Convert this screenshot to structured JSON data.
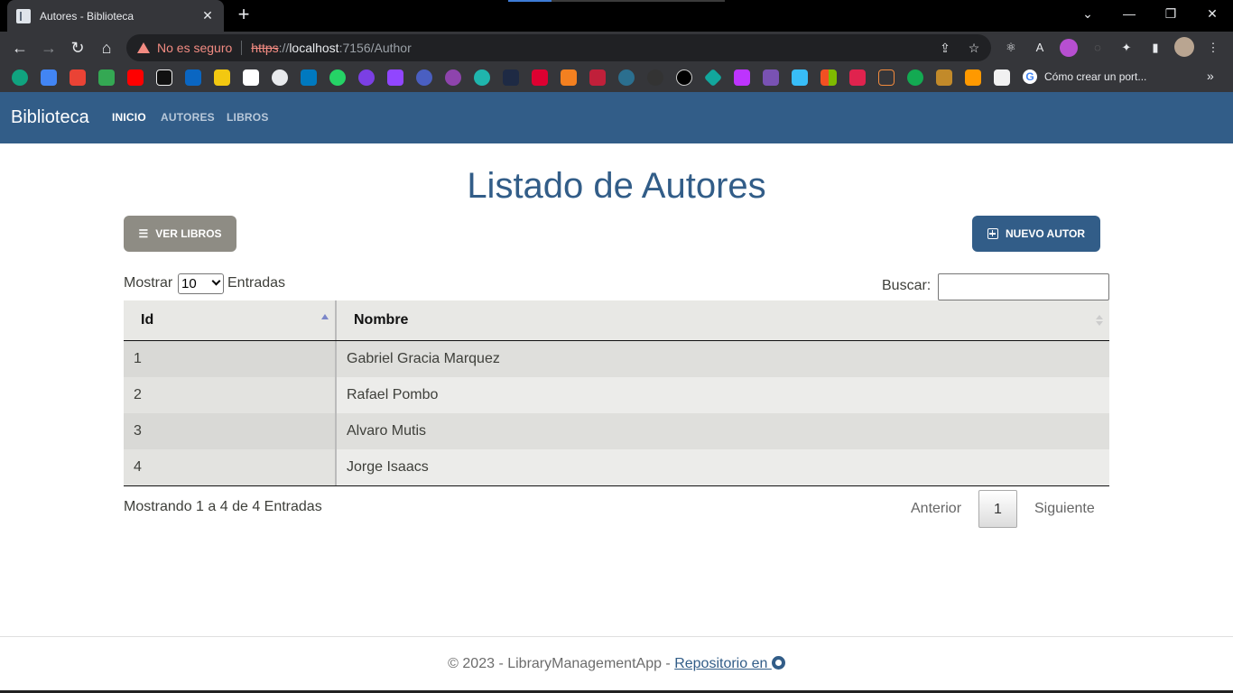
{
  "browser": {
    "tab_title": "Autores - Biblioteca",
    "tab_close": "✕",
    "new_tab": "+",
    "not_secure": "No es seguro",
    "url_scheme": "https",
    "url_sep": "://",
    "url_host": "localhost",
    "url_path": ":7156/Author",
    "bookmark_text": "Cómo crear un port...",
    "bookmarks_more": "»"
  },
  "navbar": {
    "brand": "Biblioteca",
    "links": [
      "INICIO",
      "AUTORES",
      "LIBROS"
    ],
    "active_color": "#ffffff",
    "inactive_color": "#b9c9da"
  },
  "main": {
    "title": "Listado de Autores",
    "btn_ver_libros": "VER LIBROS",
    "btn_nuevo_autor": "NUEVO AUTOR",
    "length_label_pre": "Mostrar",
    "length_value": "10",
    "length_label_post": "Entradas",
    "search_label": "Buscar:",
    "search_value": ""
  },
  "table": {
    "columns": [
      "Id",
      "Nombre"
    ],
    "rows": [
      {
        "id": "1",
        "nombre": "Gabriel Gracia Marquez"
      },
      {
        "id": "2",
        "nombre": "Rafael Pombo"
      },
      {
        "id": "3",
        "nombre": "Alvaro Mutis"
      },
      {
        "id": "4",
        "nombre": "Jorge Isaacs"
      }
    ],
    "info": "Mostrando 1 a 4 de 4 Entradas",
    "prev": "Anterior",
    "current_page": "1",
    "next": "Siguiente"
  },
  "footer": {
    "text": "© 2023 - LibraryManagementApp - ",
    "link": "Repositorio en "
  },
  "colors": {
    "brand": "#325d88",
    "secondary": "#8e8c84"
  }
}
